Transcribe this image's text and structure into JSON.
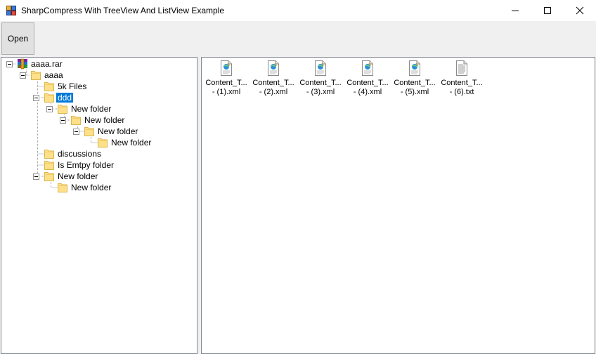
{
  "window": {
    "title": "SharpCompress With TreeView And ListView Example"
  },
  "toolbar": {
    "open_label": "Open"
  },
  "tree": {
    "archive": "aaaa.rar",
    "root_folder": "aaaa",
    "files_5k": "5k Files",
    "ddd": "ddd",
    "ddd_new_folder_1": "New folder",
    "ddd_new_folder_2": "New folder",
    "ddd_new_folder_3": "New folder",
    "ddd_new_folder_4": "New folder",
    "discussions": "discussions",
    "empty_folder": "Is Emtpy folder",
    "new_folder": "New folder",
    "new_folder_child": "New folder"
  },
  "files": [
    {
      "name1": "Content_T...",
      "name2": "- (1).xml",
      "icon": "xml-file-icon"
    },
    {
      "name1": "Content_T...",
      "name2": "- (2).xml",
      "icon": "xml-file-icon"
    },
    {
      "name1": "Content_T...",
      "name2": "- (3).xml",
      "icon": "xml-file-icon"
    },
    {
      "name1": "Content_T...",
      "name2": "- (4).xml",
      "icon": "xml-file-icon"
    },
    {
      "name1": "Content_T...",
      "name2": "- (5).xml",
      "icon": "xml-file-icon"
    },
    {
      "name1": "Content_T...",
      "name2": "- (6).txt",
      "icon": "text-file-icon"
    }
  ],
  "colors": {
    "selection": "#0078d7",
    "folder": "#ffe08a",
    "toolbar": "#f0f0f0"
  }
}
